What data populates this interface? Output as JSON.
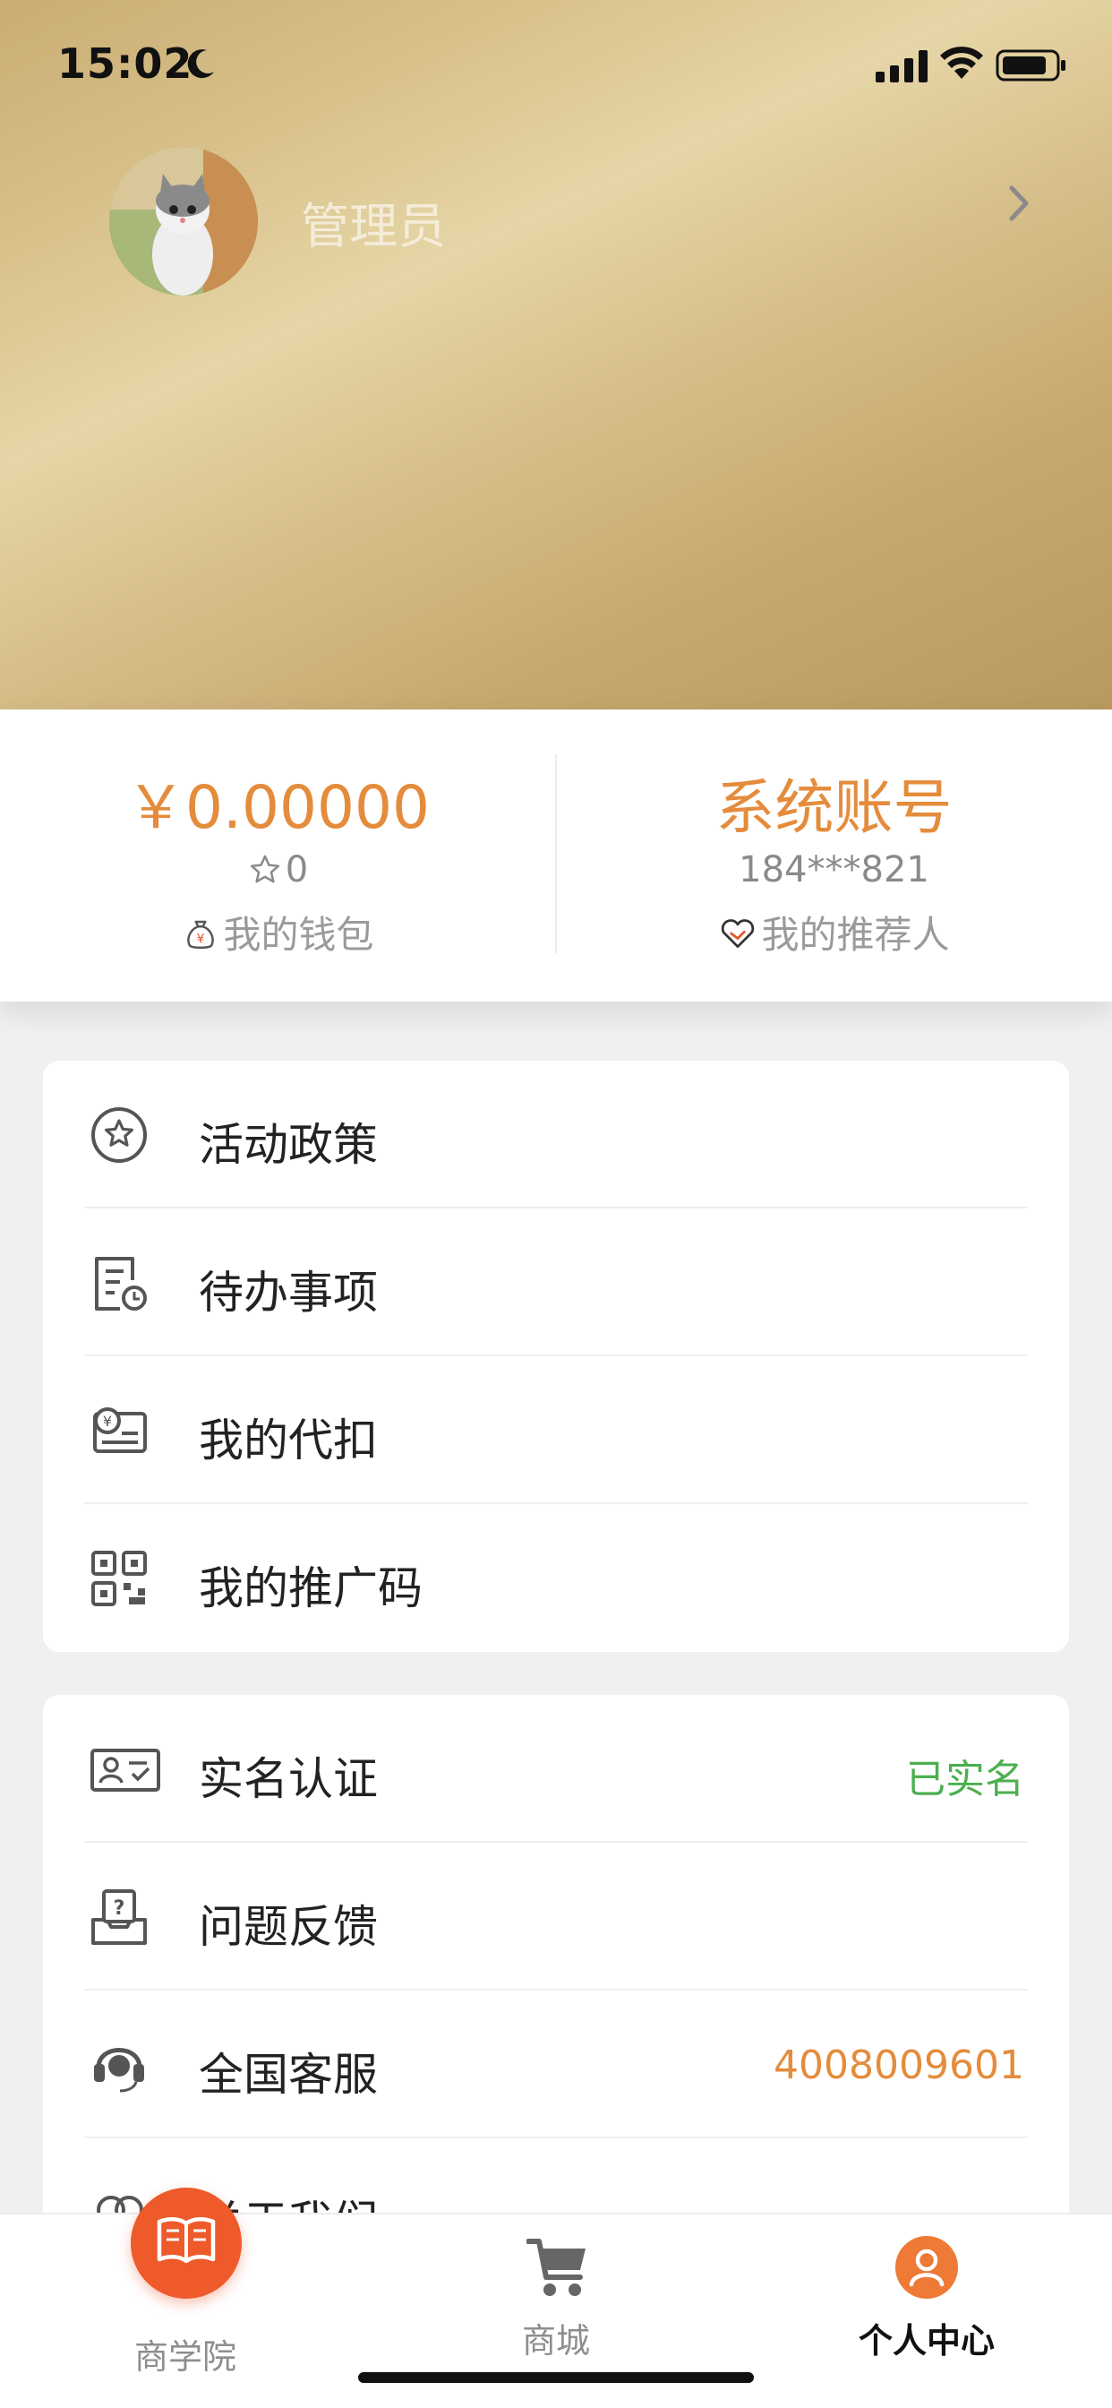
{
  "status_bar": {
    "time": "15:02"
  },
  "profile": {
    "username": "管理员"
  },
  "stats": {
    "wallet": {
      "amount": "￥0.00000",
      "points": "0",
      "label": "我的钱包"
    },
    "referrer": {
      "title": "系统账号",
      "phone": "184***821",
      "label": "我的推荐人"
    }
  },
  "menu_group_1": {
    "items": [
      {
        "label": "活动政策",
        "icon": "star-circle-icon"
      },
      {
        "label": "待办事项",
        "icon": "todo-clock-icon"
      },
      {
        "label": "我的代扣",
        "icon": "deduction-card-icon"
      },
      {
        "label": "我的推广码",
        "icon": "qr-code-icon"
      }
    ]
  },
  "menu_group_2": {
    "items": [
      {
        "label": "实名认证",
        "value": "已实名",
        "value_color": "#4caf50",
        "icon": "id-card-icon"
      },
      {
        "label": "问题反馈",
        "icon": "feedback-inbox-icon"
      },
      {
        "label": "全国客服",
        "value": "4008009601",
        "value_color": "#e48c3c",
        "icon": "headset-icon"
      },
      {
        "label": "关于我们",
        "icon": "about-us-icon"
      }
    ]
  },
  "tabbar": {
    "tabs": [
      {
        "label": "商学院",
        "icon": "book-icon"
      },
      {
        "label": "商城",
        "icon": "cart-icon"
      },
      {
        "label": "个人中心",
        "icon": "person-icon",
        "active": true
      }
    ]
  },
  "colors": {
    "accent": "#e48c3c",
    "verified": "#4caf50",
    "fab": "#ee5a2a"
  }
}
